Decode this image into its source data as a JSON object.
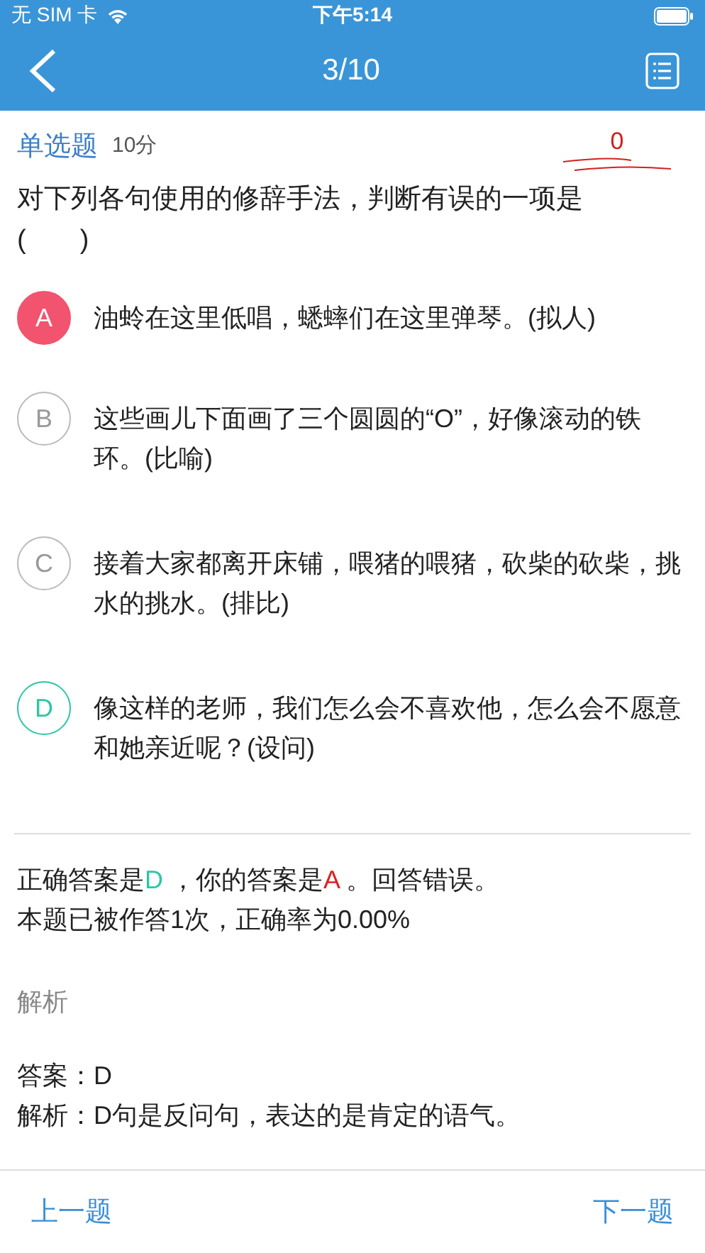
{
  "status_bar": {
    "carrier": "无 SIM 卡",
    "time": "下午5:14"
  },
  "nav": {
    "title": "3/10"
  },
  "question": {
    "type": "单选题",
    "points": "10分",
    "score": "0",
    "stem": "对下列各句使用的修辞手法，判断有误的一项是\n(　　)"
  },
  "options": [
    {
      "letter": "A",
      "text": "油蛉在这里低唱，蟋蟀们在这里弹琴。(拟人)",
      "selected": true,
      "correct": false
    },
    {
      "letter": "B",
      "text": "这些画儿下面画了三个圆圆的“O”，好像滚动的铁环。(比喻)",
      "selected": false,
      "correct": false
    },
    {
      "letter": "C",
      "text": "接着大家都离开床铺，喂猪的喂猪，砍柴的砍柴，挑水的挑水。(排比)",
      "selected": false,
      "correct": false
    },
    {
      "letter": "D",
      "text": "像这样的老师，我们怎么会不喜欢他，怎么会不愿意和她亲近呢？(设问)",
      "selected": false,
      "correct": true
    }
  ],
  "result": {
    "correct_prefix": "正确答案是",
    "correct_letter": "D",
    "your_prefix": " ，你的答案是",
    "your_letter": "A",
    "verdict": " 。回答错误。",
    "stats": "本题已被作答1次，正确率为0.00%"
  },
  "analysis": {
    "heading": "解析",
    "answer": "答案：D",
    "explanation": "解析：D句是反问句，表达的是肯定的语气。"
  },
  "footer": {
    "prev": "上一题",
    "next": "下一题"
  }
}
